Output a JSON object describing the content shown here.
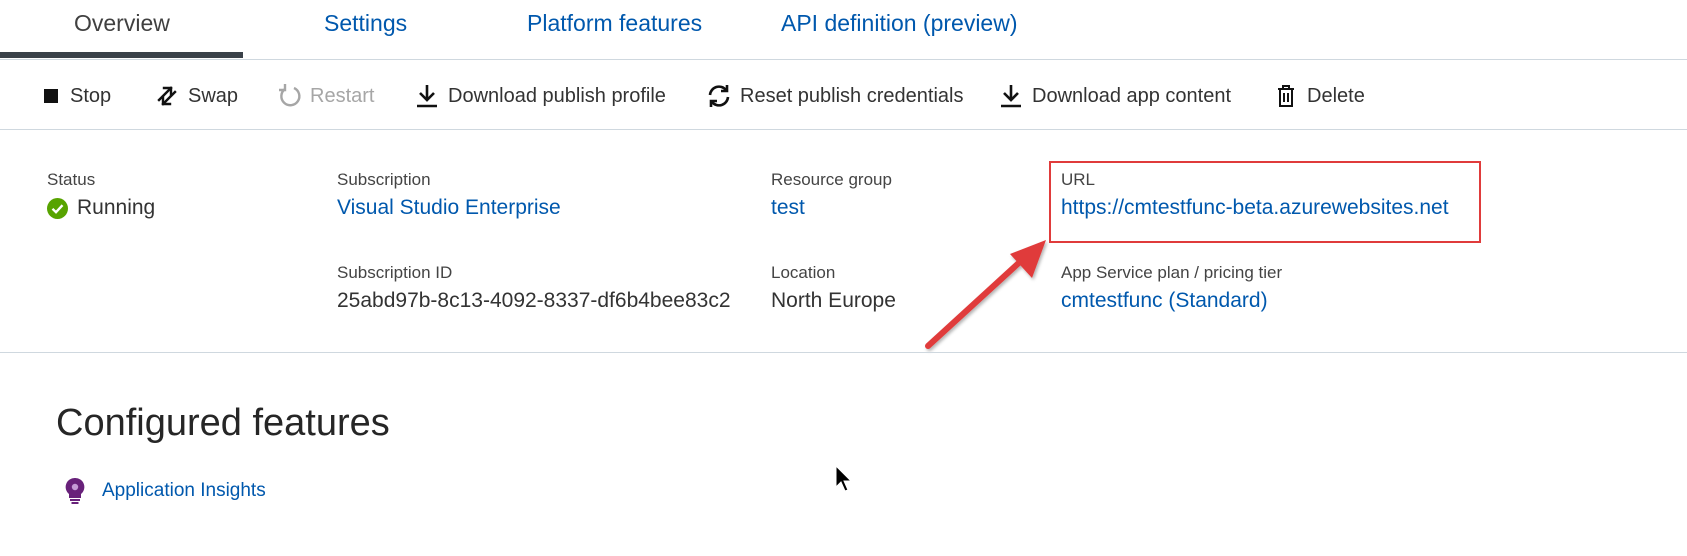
{
  "tabs": [
    {
      "label": "Overview",
      "active": true
    },
    {
      "label": "Settings"
    },
    {
      "label": "Platform features"
    },
    {
      "label": "API definition (preview)"
    }
  ],
  "toolbar": {
    "stop": "Stop",
    "swap": "Swap",
    "restart": "Restart",
    "download_publish_profile": "Download publish profile",
    "reset_publish_credentials": "Reset publish credentials",
    "download_app_content": "Download app content",
    "delete": "Delete"
  },
  "essentials": {
    "status": {
      "label": "Status",
      "value": "Running"
    },
    "subscription": {
      "label": "Subscription",
      "value": "Visual Studio Enterprise"
    },
    "subscription_id": {
      "label": "Subscription ID",
      "value": "25abd97b-8c13-4092-8337-df6b4bee83c2"
    },
    "resource_group": {
      "label": "Resource group",
      "value": "test"
    },
    "location": {
      "label": "Location",
      "value": "North Europe"
    },
    "url": {
      "label": "URL",
      "value": "https://cmtestfunc-beta.azurewebsites.net"
    },
    "plan": {
      "label": "App Service plan / pricing tier",
      "value": "cmtestfunc (Standard)"
    }
  },
  "configured_features": {
    "title": "Configured features",
    "items": [
      {
        "label": "Application Insights",
        "icon": "lightbulb-icon"
      }
    ]
  },
  "colors": {
    "link": "#0058ad",
    "status_ok": "#57a300",
    "annotation": "#e03b3b",
    "insights_icon": "#68217a"
  }
}
